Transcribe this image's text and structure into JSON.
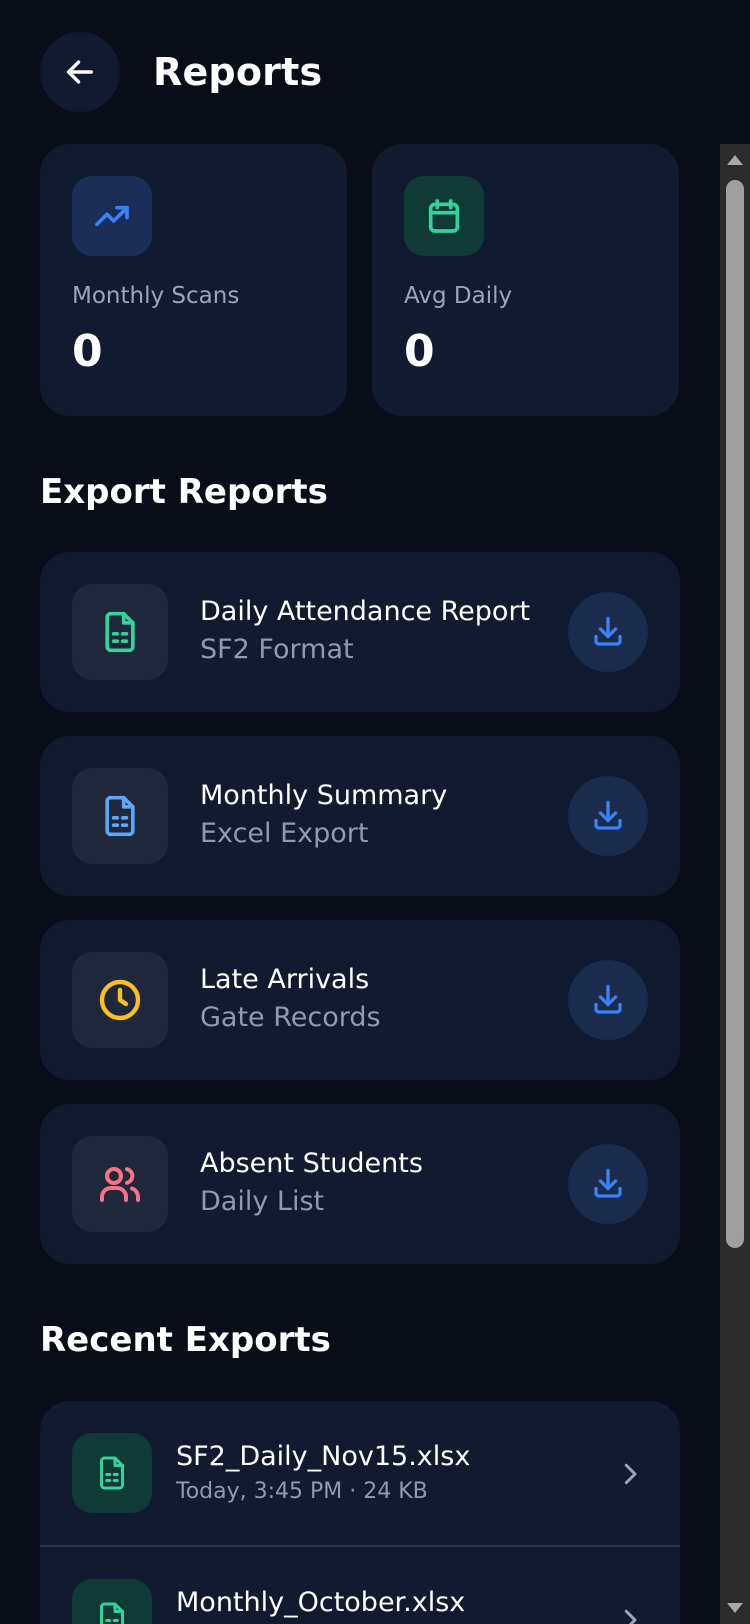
{
  "header": {
    "title": "Reports"
  },
  "stats": [
    {
      "label": "Monthly Scans",
      "value": "0",
      "icon": "trending-up-icon",
      "accent": "#3b82f6",
      "icon_bg": "#1b2d57"
    },
    {
      "label": "Avg Daily",
      "value": "0",
      "icon": "calendar-icon",
      "accent": "#34d399",
      "icon_bg": "#0f3a36"
    }
  ],
  "export_section": {
    "title": "Export Reports",
    "items": [
      {
        "title": "Daily Attendance Report",
        "subtitle": "SF2 Format",
        "icon": "spreadsheet-file-icon",
        "accent": "#34d399"
      },
      {
        "title": "Monthly Summary",
        "subtitle": "Excel Export",
        "icon": "spreadsheet-file-icon",
        "accent": "#60a5fa"
      },
      {
        "title": "Late Arrivals",
        "subtitle": "Gate Records",
        "icon": "clock-icon",
        "accent": "#fbbf24"
      },
      {
        "title": "Absent Students",
        "subtitle": "Daily List",
        "icon": "users-icon",
        "accent": "#f87185"
      }
    ]
  },
  "recent_section": {
    "title": "Recent Exports",
    "items": [
      {
        "name": "SF2_Daily_Nov15.xlsx",
        "meta": "Today, 3:45 PM · 24 KB"
      },
      {
        "name": "Monthly_October.xlsx",
        "meta": ""
      }
    ]
  },
  "colors": {
    "background": "#090d18",
    "card": "#111a2e",
    "download_accent": "#3b82f6"
  }
}
